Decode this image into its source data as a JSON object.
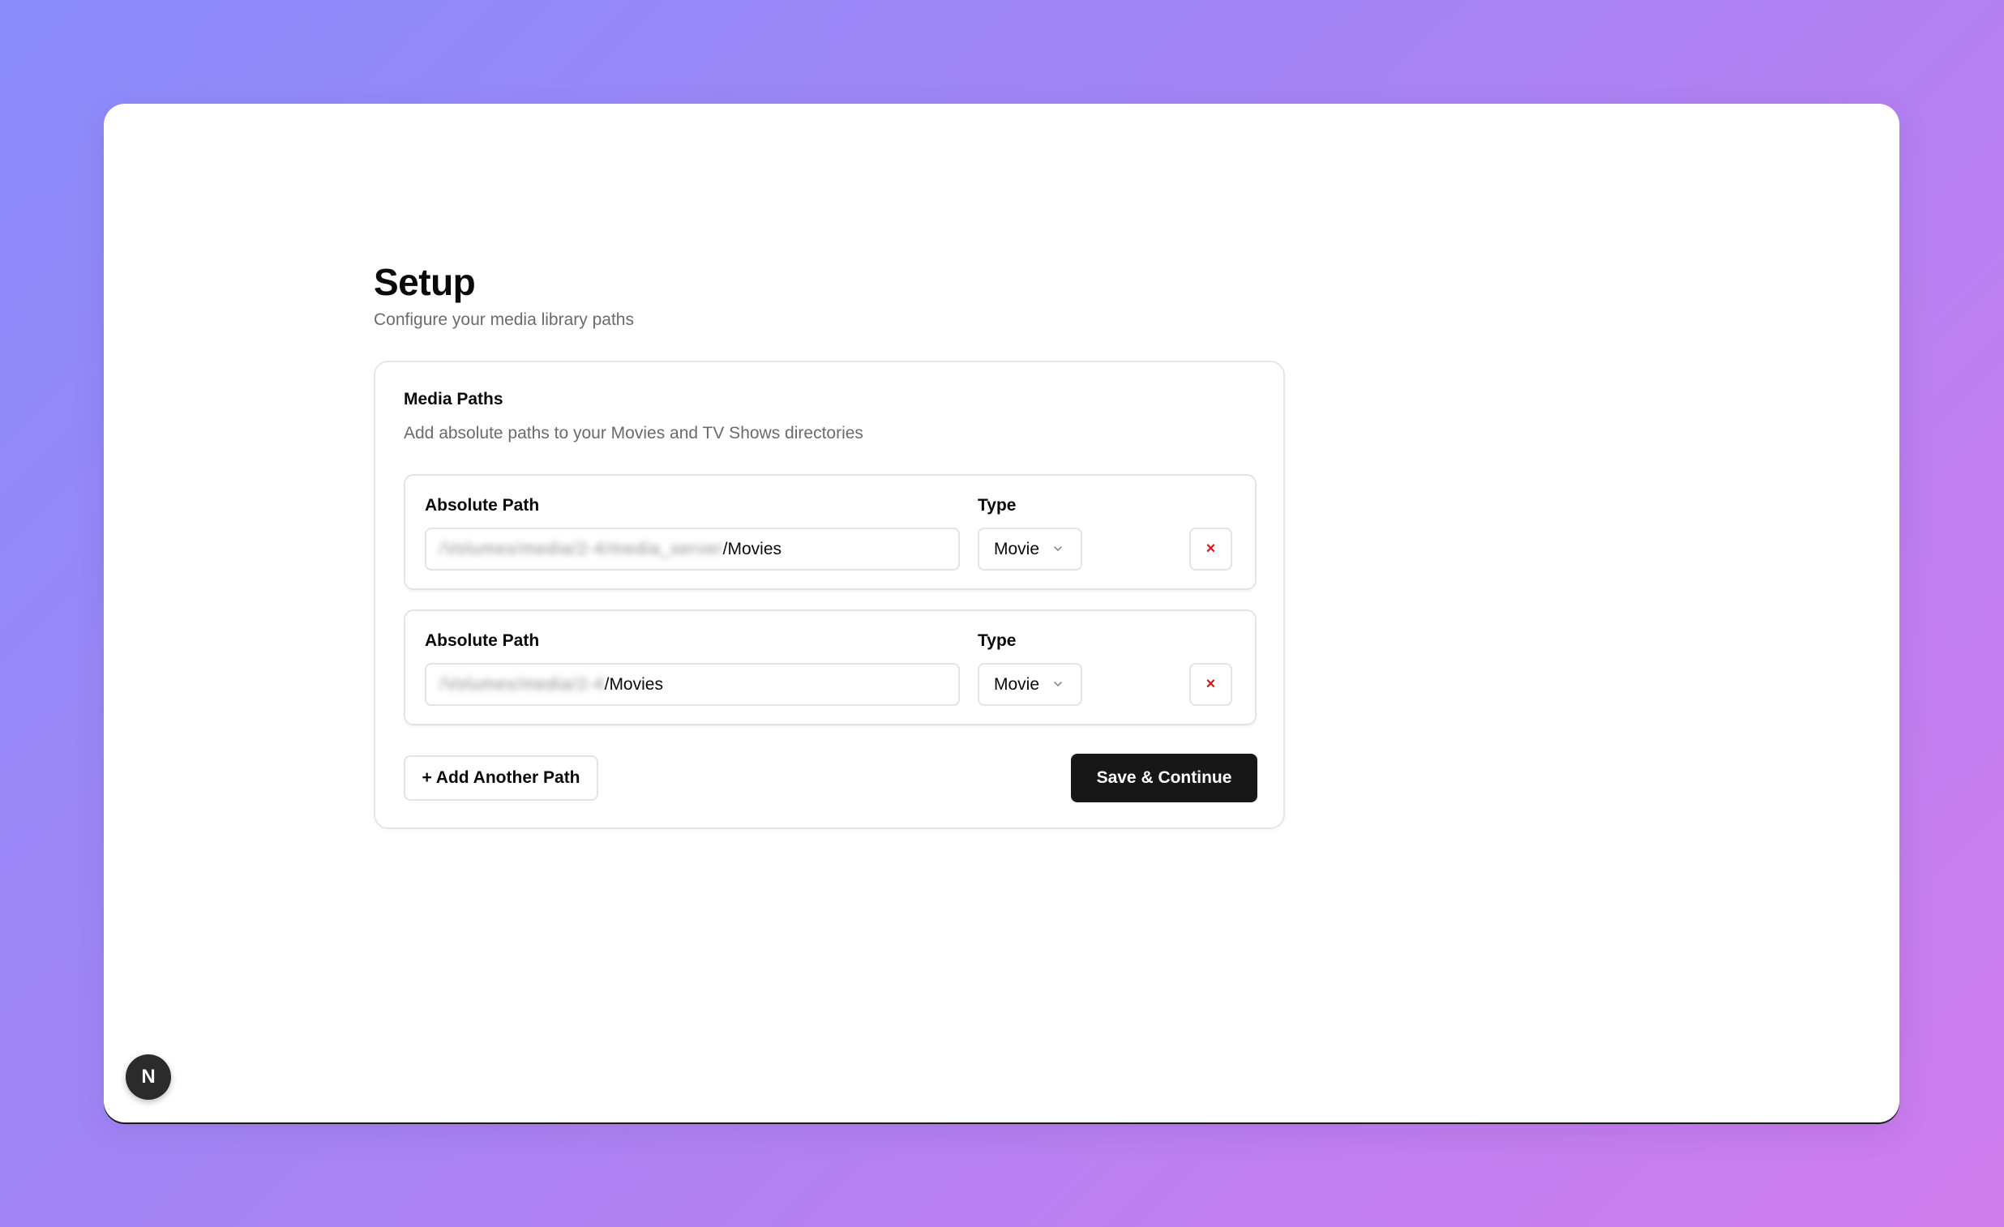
{
  "page": {
    "title": "Setup",
    "subtitle": "Configure your media library paths"
  },
  "card": {
    "title": "Media Paths",
    "description": "Add absolute paths to your Movies and TV Shows directories",
    "rows": [
      {
        "path_label": "Absolute Path",
        "path_value_redacted": "/Volumes/media/2-4/media_server",
        "path_value_visible": "/Movies",
        "type_label": "Type",
        "type_value": "Movie",
        "remove_symbol": "×"
      },
      {
        "path_label": "Absolute Path",
        "path_value_redacted": "/Volumes/media/2-4",
        "path_value_visible": "/Movies",
        "type_label": "Type",
        "type_value": "Movie",
        "remove_symbol": "×"
      }
    ],
    "add_button_label": "+ Add Another Path",
    "save_button_label": "Save & Continue"
  },
  "dev_badge": {
    "letter": "N"
  },
  "colors": {
    "primary_button": "#171717",
    "remove_icon": "#d11a1a",
    "background_gradient_start": "#8b8cfb",
    "background_gradient_end": "#cf7ded"
  }
}
